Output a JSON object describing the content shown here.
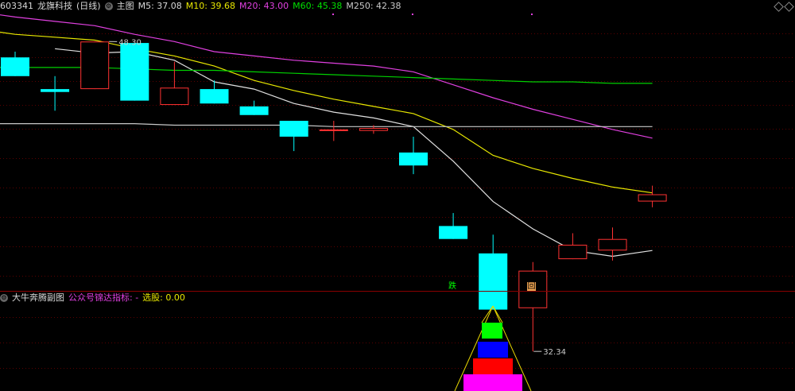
{
  "header": {
    "code": "603341",
    "name": "龙旗科技",
    "period": "(日线)",
    "main_label": "主图",
    "m5": "M5: 37.08",
    "m10": "M10: 39.68",
    "m20": "M20: 43.00",
    "m60": "M60: 45.38",
    "m250": "M250: 42.38"
  },
  "sub_header": {
    "title": "大牛奔腾副图",
    "indicator": "公众号锦达指标: -",
    "select": "选股: 0.00"
  },
  "annotations": {
    "high_label": "48.30",
    "low_label": "32.34",
    "fall_badge": "跌",
    "back_badge": "回"
  },
  "colors": {
    "up": "#ff3232",
    "down": "#00ffff",
    "m5": "#e0e0e0",
    "m10": "#e8e800",
    "m20": "#e040e0",
    "m60": "#00d000",
    "m250": "#c8c8c8",
    "grid": "#5a0000"
  },
  "chart_data": {
    "type": "candlestick",
    "price_range": [
      31.0,
      50.3
    ],
    "candles": [
      {
        "open": 47.2,
        "close": 45.9,
        "high": 47.6,
        "low": 45.9
      },
      {
        "open": 45.0,
        "close": 44.8,
        "high": 45.9,
        "low": 43.5
      },
      {
        "open": 45.0,
        "close": 48.3,
        "high": 48.3,
        "low": 45.0
      },
      {
        "open": 48.2,
        "close": 44.2,
        "high": 48.2,
        "low": 44.2
      },
      {
        "open": 43.9,
        "close": 45.1,
        "high": 46.9,
        "low": 43.9
      },
      {
        "open": 45.0,
        "close": 44.0,
        "high": 45.6,
        "low": 44.0
      },
      {
        "open": 43.8,
        "close": 43.2,
        "high": 44.2,
        "low": 43.2
      },
      {
        "open": 42.8,
        "close": 41.7,
        "high": 42.8,
        "low": 40.7
      },
      {
        "open": 42.2,
        "close": 42.2,
        "high": 42.8,
        "low": 41.4
      },
      {
        "open": 42.1,
        "close": 42.3,
        "high": 42.5,
        "low": 41.9
      },
      {
        "open": 40.6,
        "close": 39.7,
        "high": 41.7,
        "low": 39.1
      },
      {
        "open": 35.5,
        "close": 34.6,
        "high": 36.4,
        "low": 34.6
      },
      {
        "open": 33.6,
        "close": 29.7,
        "high": 34.9,
        "low": 29.7
      },
      {
        "open": 29.8,
        "close": 32.4,
        "high": 33.0,
        "low": 26.8
      },
      {
        "open": 33.2,
        "close": 34.2,
        "high": 35.0,
        "low": 33.2
      },
      {
        "open": 33.8,
        "close": 34.6,
        "high": 35.4,
        "low": 33.1
      },
      {
        "open": 37.2,
        "close": 37.7,
        "high": 38.3,
        "low": 36.8
      }
    ],
    "ma_lines": [
      {
        "name": "M5",
        "values": [
          null,
          47.8,
          47.5,
          47.6,
          47.0,
          45.5,
          45.0,
          44.0,
          43.4,
          43.0,
          42.4,
          40.0,
          37.2,
          35.3,
          33.8,
          33.4,
          33.8
        ]
      },
      {
        "name": "M10",
        "values": [
          48.8,
          48.6,
          48.4,
          47.8,
          47.3,
          46.6,
          45.6,
          44.9,
          44.3,
          43.8,
          43.3,
          42.2,
          40.4,
          39.5,
          38.8,
          38.2,
          37.8
        ]
      },
      {
        "name": "M20",
        "values": [
          50.0,
          49.7,
          49.4,
          48.8,
          48.3,
          47.6,
          47.3,
          47.0,
          46.8,
          46.6,
          46.2,
          45.3,
          44.4,
          43.6,
          42.9,
          42.2,
          41.6
        ]
      },
      {
        "name": "M60",
        "values": [
          46.5,
          46.5,
          46.5,
          46.4,
          46.3,
          46.3,
          46.2,
          46.1,
          46.0,
          45.9,
          45.8,
          45.7,
          45.6,
          45.5,
          45.5,
          45.4,
          45.4
        ]
      },
      {
        "name": "M250",
        "values": [
          42.6,
          42.6,
          42.6,
          42.6,
          42.5,
          42.5,
          42.5,
          42.5,
          42.4,
          42.4,
          42.4,
          42.4,
          42.4,
          42.4,
          42.4,
          42.4,
          42.4
        ]
      }
    ],
    "high_marker": {
      "candle": 2,
      "value": 48.3
    },
    "low_marker": {
      "candle": 13,
      "value": 26.8
    }
  }
}
